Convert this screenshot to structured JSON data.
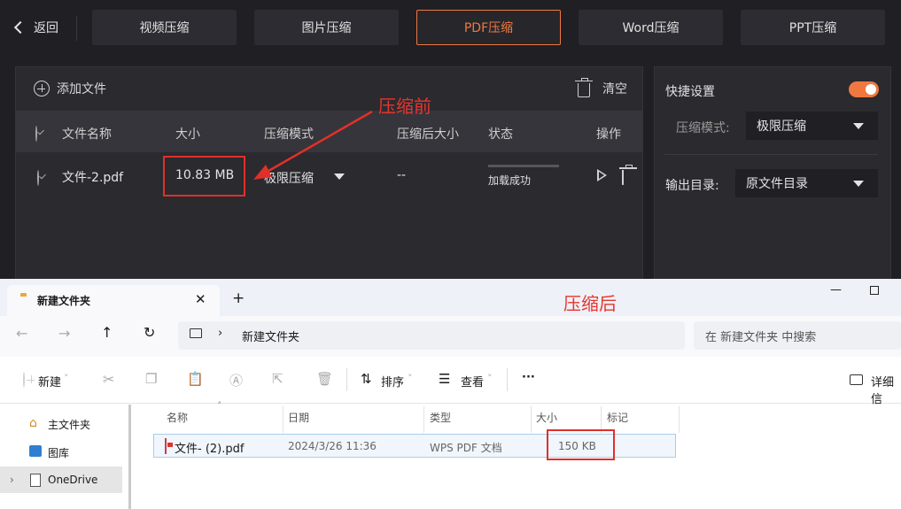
{
  "nav": {
    "back": "返回",
    "tabs": [
      {
        "label": "视频压缩",
        "active": false
      },
      {
        "label": "图片压缩",
        "active": false
      },
      {
        "label": "PDF压缩",
        "active": true
      },
      {
        "label": "Word压缩",
        "active": false
      },
      {
        "label": "PPT压缩",
        "active": false
      }
    ]
  },
  "toolbar": {
    "add_file": "添加文件",
    "clear": "清空"
  },
  "table": {
    "headers": [
      "文件名称",
      "大小",
      "压缩模式",
      "压缩后大小",
      "状态",
      "操作"
    ],
    "row": {
      "name": "文件-2.pdf",
      "size": "10.83 MB",
      "mode": "极限压缩",
      "compressed": "--",
      "status": "加载成功"
    }
  },
  "side": {
    "title": "快捷设置",
    "mode_label": "压缩模式:",
    "mode_value": "极限压缩",
    "output_label": "输出目录:",
    "output_value": "原文件目录"
  },
  "annotations": {
    "before": "压缩前",
    "after": "压缩后"
  },
  "explorer": {
    "tab_title": "新建文件夹",
    "path": "新建文件夹",
    "search_placeholder": "在 新建文件夹 中搜索",
    "toolbar": {
      "new": "新建",
      "sort": "排序",
      "view": "查看",
      "more": "···",
      "details": "详细信"
    },
    "nav": [
      "主文件夹",
      "图库",
      "OneDrive"
    ],
    "headers": [
      "名称",
      "日期",
      "类型",
      "大小",
      "标记"
    ],
    "file": {
      "name": "文件- (2).pdf",
      "date": "2024/3/26 11:36",
      "type": "WPS PDF 文档",
      "size": "150 KB"
    }
  },
  "colors": {
    "accent": "#f07840",
    "highlight": "#e0302a",
    "panel": "#2a2a2f"
  }
}
